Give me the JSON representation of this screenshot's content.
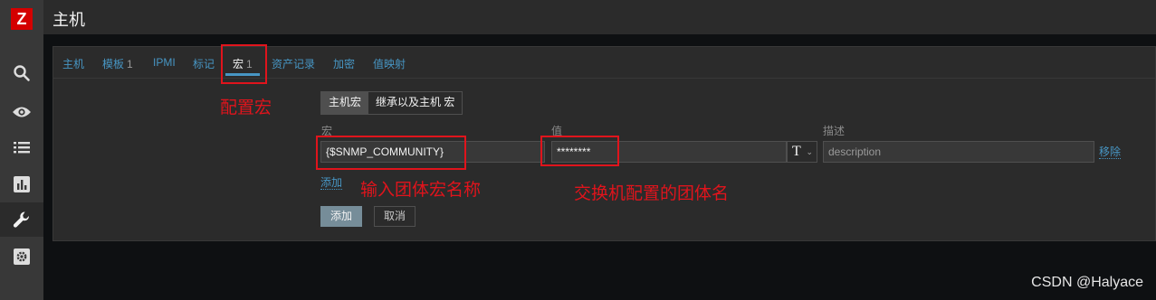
{
  "app": {
    "logo_letter": "Z",
    "title": "主机"
  },
  "sidebar": {
    "items": [
      {
        "icon": "search-icon",
        "active": false
      },
      {
        "icon": "eye-icon",
        "active": false
      },
      {
        "icon": "list-icon",
        "active": false
      },
      {
        "icon": "bar-chart-icon",
        "active": false
      },
      {
        "icon": "wrench-icon",
        "active": true
      },
      {
        "icon": "gear-icon",
        "active": false
      }
    ]
  },
  "tabs": [
    {
      "label": "主机",
      "count": ""
    },
    {
      "label": "模板",
      "count": "1"
    },
    {
      "label": "IPMI",
      "count": ""
    },
    {
      "label": "标记",
      "count": ""
    },
    {
      "label": "宏",
      "count": "1",
      "active": true
    },
    {
      "label": "资产记录",
      "count": ""
    },
    {
      "label": "加密",
      "count": ""
    },
    {
      "label": "值映射",
      "count": ""
    }
  ],
  "macros": {
    "segment": {
      "host_label": "主机宏",
      "inherited_label": "继承以及主机 宏"
    },
    "headers": {
      "macro": "宏",
      "value": "值",
      "description": "描述"
    },
    "row": {
      "macro": "{$SNMP_COMMUNITY}",
      "value": "********",
      "type_symbol": "T",
      "description_placeholder": "description",
      "remove_label": "移除"
    },
    "add_link": "添加"
  },
  "buttons": {
    "add": "添加",
    "cancel": "取消"
  },
  "annotations": {
    "configure_macro": "配置宏",
    "enter_macro_name": "输入团体宏名称",
    "switch_community": "交换机配置的团体名"
  },
  "watermark": "CSDN @Halyace",
  "colors": {
    "accent": "#4796c4",
    "annotation": "#e0141c",
    "logo": "#d40000"
  }
}
